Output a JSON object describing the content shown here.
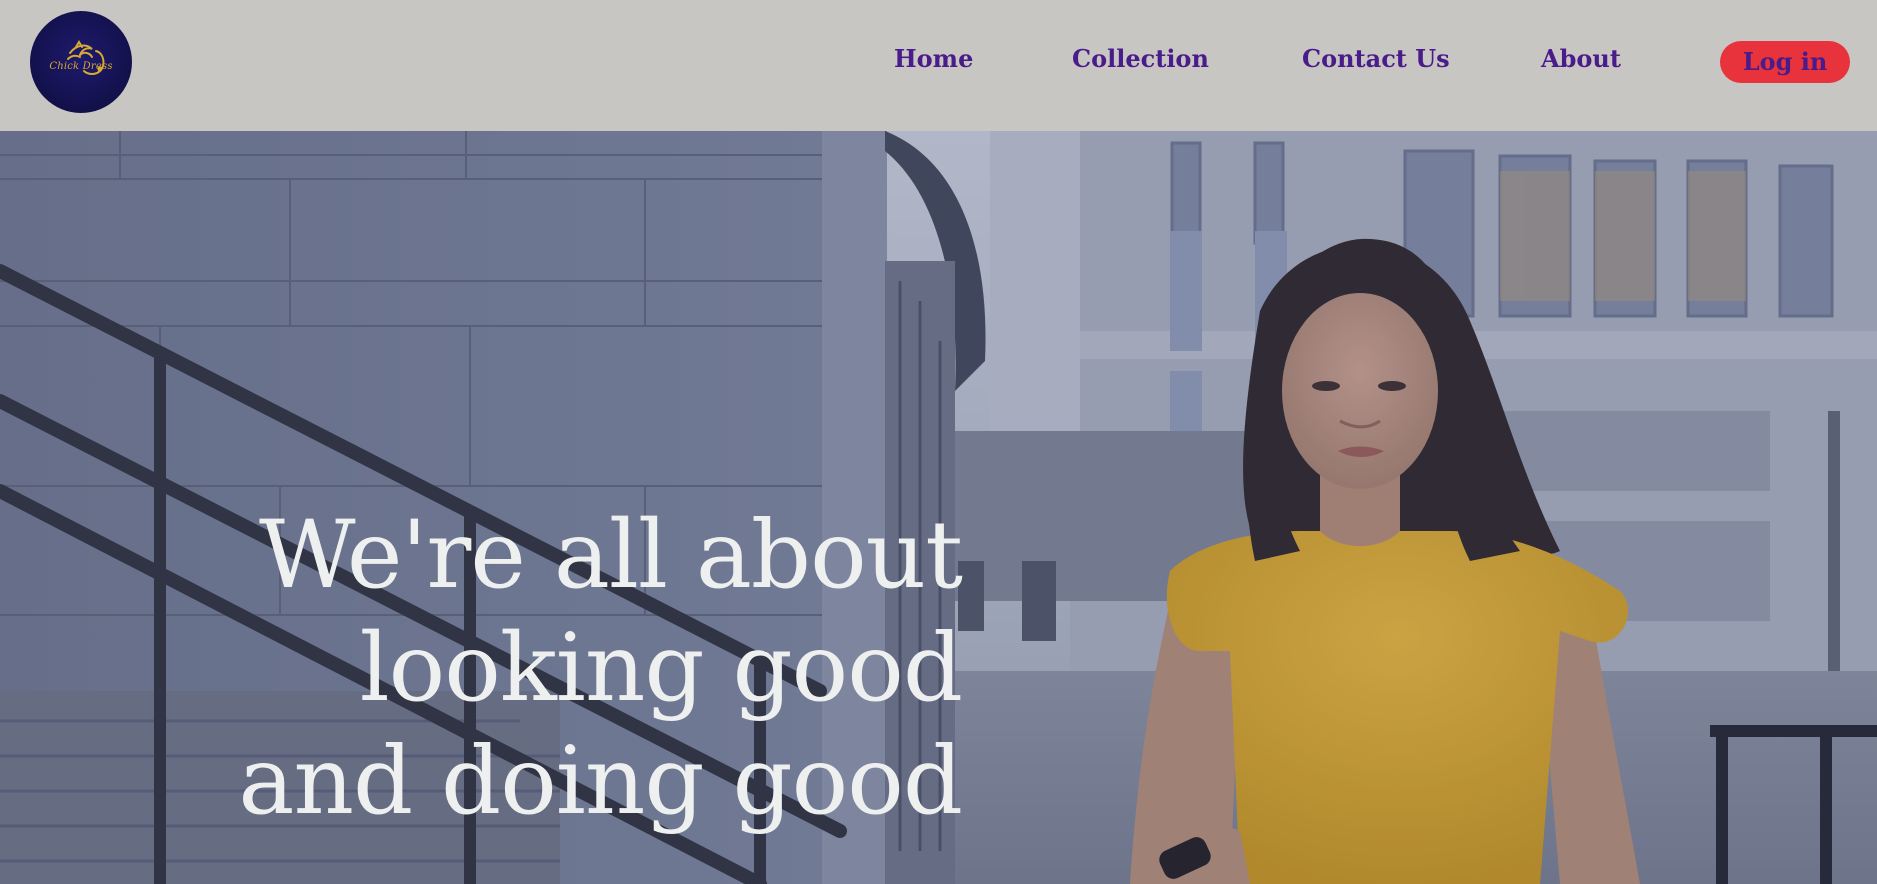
{
  "header": {
    "logo": {
      "icon": "logo-emblem-icon",
      "text": "Chick Dress",
      "background": "#14124f",
      "accent": "#d8a935"
    },
    "nav": {
      "items": [
        {
          "label": "Home"
        },
        {
          "label": "Collection"
        },
        {
          "label": "Contact Us"
        },
        {
          "label": "About"
        }
      ],
      "link_color": "#4a1b8a"
    },
    "login": {
      "label": "Log in",
      "background": "#e8333c"
    },
    "background": "#c8c6c2"
  },
  "hero": {
    "heading_lines": [
      "We're all about",
      "looking good",
      "and doing good"
    ],
    "media": "video-background",
    "heading_color": "#eef0f0"
  }
}
